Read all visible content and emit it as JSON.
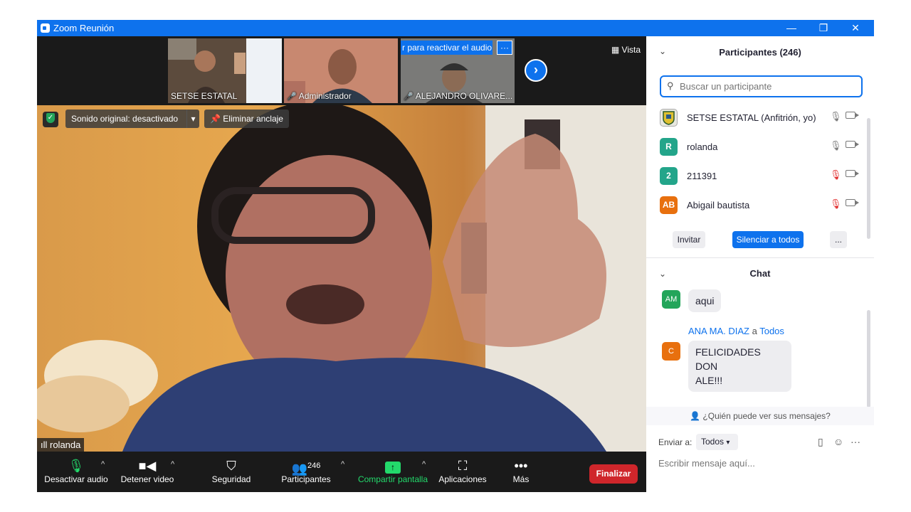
{
  "window": {
    "title": "Zoom Reunión",
    "minimize": "—",
    "restore": "❐",
    "close": "✕"
  },
  "thumbnails": [
    {
      "name": "SETSE ESTATAL",
      "muted": false
    },
    {
      "name": "Administrador",
      "muted": true
    },
    {
      "name": "ALEJANDRO OLIVARE...",
      "muted": true,
      "banner": "r para reactivar el audio",
      "banner_more": "···"
    }
  ],
  "view_label": "Vista",
  "overlay": {
    "original_sound": "Sonido original: desactivado",
    "unpin": "Eliminar anclaje"
  },
  "active_speaker": "rolanda",
  "toolbar": {
    "mute_audio": "Desactivar audio",
    "stop_video": "Detener video",
    "security": "Seguridad",
    "participants": "Participantes",
    "participants_count": "246",
    "share_screen": "Compartir pantalla",
    "apps": "Aplicaciones",
    "more": "Más",
    "end": "Finalizar"
  },
  "participants_panel": {
    "title": "Participantes (246)",
    "search_placeholder": "Buscar un participante",
    "participants": [
      {
        "name": "SETSE ESTATAL (Anfitrión, yo)",
        "avatar": "",
        "color": "#e8e8e0",
        "muted": false
      },
      {
        "name": "rolanda",
        "avatar": "R",
        "color": "#23a58a",
        "muted": false
      },
      {
        "name": "211391",
        "avatar": "2",
        "color": "#23a58a",
        "muted": true
      },
      {
        "name": "Abigail bautista",
        "avatar": "AB",
        "color": "#e8700e",
        "muted": true
      }
    ],
    "invite": "Invitar",
    "mute_all": "Silenciar a todos",
    "more": "..."
  },
  "chat": {
    "title": "Chat",
    "messages": [
      {
        "avatar": "AM",
        "avatar_color": "#23a55a",
        "text": "aqui"
      },
      {
        "sender": "ANA MA. DIAZ",
        "to_word": "a",
        "recipient": "Todos",
        "avatar": "C",
        "avatar_color": "#e8700e",
        "text_line1": "FELICIDADES DON",
        "text_line2": "ALE!!!"
      }
    ],
    "who_can_see": "¿Quién puede ver sus mensajes?",
    "send_to_label": "Enviar a:",
    "send_to_value": "Todos",
    "input_placeholder": "Escribir mensaje aquí..."
  }
}
